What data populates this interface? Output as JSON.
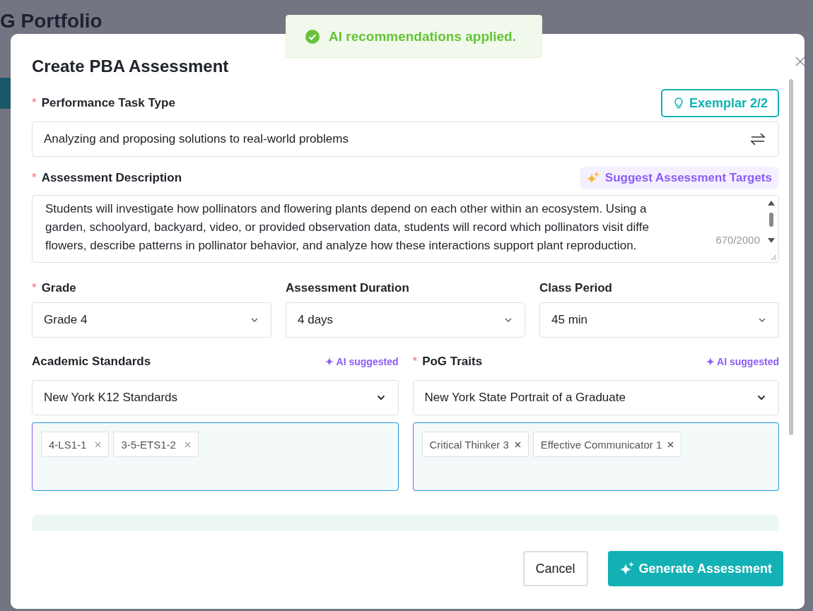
{
  "background": {
    "title": "G Portfolio"
  },
  "toast": {
    "message": "AI recommendations applied."
  },
  "dialog": {
    "title": "Create PBA Assessment",
    "task_type": {
      "label": "Performance Task Type",
      "marker": "*",
      "exemplar": "Exemplar 2/2",
      "value": "Analyzing and proposing solutions to real-world problems"
    },
    "description": {
      "label": "Assessment Description",
      "marker": "*",
      "suggest": "Suggest Assessment Targets",
      "lines": [
        "Students will investigate how pollinators and flowering plants depend on each other within an ecosystem. Using a",
        "garden, schoolyard, backyard, video, or provided observation data, students will record which pollinators visit diffe",
        "flowers, describe patterns in pollinator behavior, and analyze how these interactions support plant reproduction."
      ],
      "counter": "670/2000"
    },
    "selects": [
      {
        "label": "Grade",
        "marker": "*",
        "value": "Grade 4"
      },
      {
        "label": "Assessment Duration",
        "value": "4 days"
      },
      {
        "label": "Class Period",
        "value": "45 min"
      }
    ],
    "tag_groups": [
      {
        "label": "Academic Standards",
        "badge": "✦ AI suggested",
        "value": "New York K12 Standards",
        "tags": [
          "4-LS1-1",
          "3-5-ETS1-2"
        ]
      },
      {
        "label": "PoG Traits",
        "marker": "*",
        "badge": "✦ AI suggested",
        "value": "New York State Portrait of a Graduate",
        "tags": [
          "Critical Thinker 3",
          "Effective Communicator 1"
        ]
      }
    ],
    "buttons": [
      {
        "label": "Cancel",
        "kind": "secondary"
      },
      {
        "label": "Generate Assessment",
        "kind": "primary"
      }
    ]
  }
}
